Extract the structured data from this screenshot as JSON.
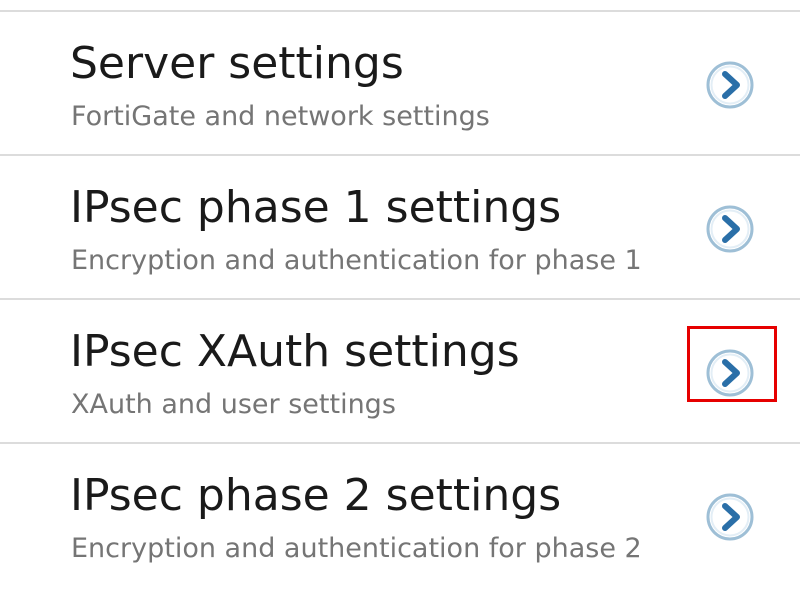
{
  "colors": {
    "highlight": "#e60000",
    "chevron_ring": "#9ebfd6",
    "chevron_fill": "#ffffff",
    "chevron_arrow": "#2a6fa8"
  },
  "settings_list": {
    "items": [
      {
        "title": "Server settings",
        "subtitle": "FortiGate and network settings",
        "icon": "chevron-right-icon",
        "highlighted": false
      },
      {
        "title": "IPsec phase 1 settings",
        "subtitle": "Encryption and authentication for phase 1",
        "icon": "chevron-right-icon",
        "highlighted": false
      },
      {
        "title": "IPsec XAuth settings",
        "subtitle": "XAuth and user settings",
        "icon": "chevron-right-icon",
        "highlighted": true
      },
      {
        "title": "IPsec phase 2 settings",
        "subtitle": "Encryption and authentication for phase 2",
        "icon": "chevron-right-icon",
        "highlighted": false
      }
    ]
  }
}
